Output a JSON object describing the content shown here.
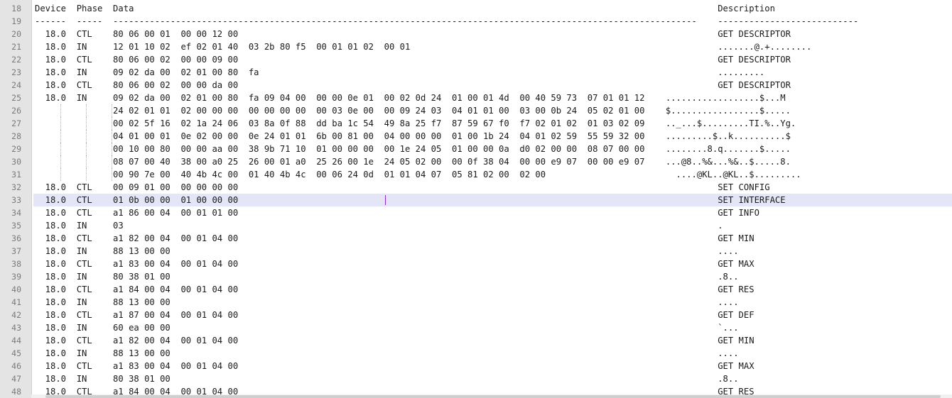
{
  "editor": {
    "current_line": 33,
    "lines": [
      {
        "n": "18",
        "t": "Device  Phase  Data                                                                                                                Description"
      },
      {
        "n": "19",
        "t": "------  -----  ----------------------------------------------------------------------------------------------------------------    ---------------------------"
      },
      {
        "n": "20",
        "t": "  18.0  CTL    80 06 00 01  00 00 12 00                                                                                            GET DESCRIPTOR"
      },
      {
        "n": "21",
        "t": "  18.0  IN     12 01 10 02  ef 02 01 40  03 2b 80 f5  00 01 01 02  00 01                                                           .......@.+........"
      },
      {
        "n": "22",
        "t": "  18.0  CTL    80 06 00 02  00 00 09 00                                                                                            GET DESCRIPTOR"
      },
      {
        "n": "23",
        "t": "  18.0  IN     09 02 da 00  02 01 00 80  fa                                                                                        ........."
      },
      {
        "n": "24",
        "t": "  18.0  CTL    80 06 00 02  00 00 da 00                                                                                            GET DESCRIPTOR"
      },
      {
        "n": "25",
        "t": "  18.0  IN     09 02 da 00  02 01 00 80  fa 09 04 00  00 00 0e 01  00 02 0d 24  01 00 01 4d  00 40 59 73  07 01 01 12    ..................$...M"
      },
      {
        "n": "26",
        "t": "               24 02 01 01  02 00 00 00  00 00 00 00  00 03 0e 00  00 09 24 03  04 01 01 00  03 00 0b 24  05 02 01 00    $.................$....."
      },
      {
        "n": "27",
        "t": "               00 02 5f 16  02 1a 24 06  03 8a 0f 88  dd ba 1c 54  49 8a 25 f7  87 59 67 f0  f7 02 01 02  01 03 02 09    .._...$.........TI.%..Yg."
      },
      {
        "n": "28",
        "t": "               04 01 00 01  0e 02 00 00  0e 24 01 01  6b 00 81 00  04 00 00 00  01 00 1b 24  04 01 02 59  55 59 32 00    .........$..k..........$"
      },
      {
        "n": "29",
        "t": "               00 10 00 80  00 00 aa 00  38 9b 71 10  01 00 00 00  00 1e 24 05  01 00 00 0a  d0 02 00 00  08 07 00 00    ........8.q.......$....."
      },
      {
        "n": "30",
        "t": "               08 07 00 40  38 00 a0 25  26 00 01 a0  25 26 00 1e  24 05 02 00  00 0f 38 04  00 00 e9 07  00 00 e9 07    ...@8..%&...%&..$.....8."
      },
      {
        "n": "31",
        "t": "               00 90 7e 00  40 4b 4c 00  01 40 4b 4c  00 06 24 0d  01 01 04 07  05 81 02 00  02 00                         ....@KL..@KL..$........."
      },
      {
        "n": "32",
        "t": "  18.0  CTL    00 09 01 00  00 00 00 00                                                                                            SET CONFIG"
      },
      {
        "n": "33",
        "t": "  18.0  CTL    01 0b 00 00  01 00 00 00                                                                                            SET INTERFACE"
      },
      {
        "n": "34",
        "t": "  18.0  CTL    a1 86 00 04  00 01 01 00                                                                                            GET INFO"
      },
      {
        "n": "35",
        "t": "  18.0  IN     03                                                                                                                  ."
      },
      {
        "n": "36",
        "t": "  18.0  CTL    a1 82 00 04  00 01 04 00                                                                                            GET MIN"
      },
      {
        "n": "37",
        "t": "  18.0  IN     88 13 00 00                                                                                                         ...."
      },
      {
        "n": "38",
        "t": "  18.0  CTL    a1 83 00 04  00 01 04 00                                                                                            GET MAX"
      },
      {
        "n": "39",
        "t": "  18.0  IN     80 38 01 00                                                                                                         .8.."
      },
      {
        "n": "40",
        "t": "  18.0  CTL    a1 84 00 04  00 01 04 00                                                                                            GET RES"
      },
      {
        "n": "41",
        "t": "  18.0  IN     88 13 00 00                                                                                                         ...."
      },
      {
        "n": "42",
        "t": "  18.0  CTL    a1 87 00 04  00 01 04 00                                                                                            GET DEF"
      },
      {
        "n": "43",
        "t": "  18.0  IN     60 ea 00 00                                                                                                         `..."
      },
      {
        "n": "44",
        "t": "  18.0  CTL    a1 82 00 04  00 01 04 00                                                                                            GET MIN"
      },
      {
        "n": "45",
        "t": "  18.0  IN     88 13 00 00                                                                                                         ...."
      },
      {
        "n": "46",
        "t": "  18.0  CTL    a1 83 00 04  00 01 04 00                                                                                            GET MAX"
      },
      {
        "n": "47",
        "t": "  18.0  IN     80 38 01 00                                                                                                         .8.."
      },
      {
        "n": "48",
        "t": "  18.0  CTL    a1 84 00 04  00 01 04 00                                                                                            GET RES"
      }
    ]
  }
}
